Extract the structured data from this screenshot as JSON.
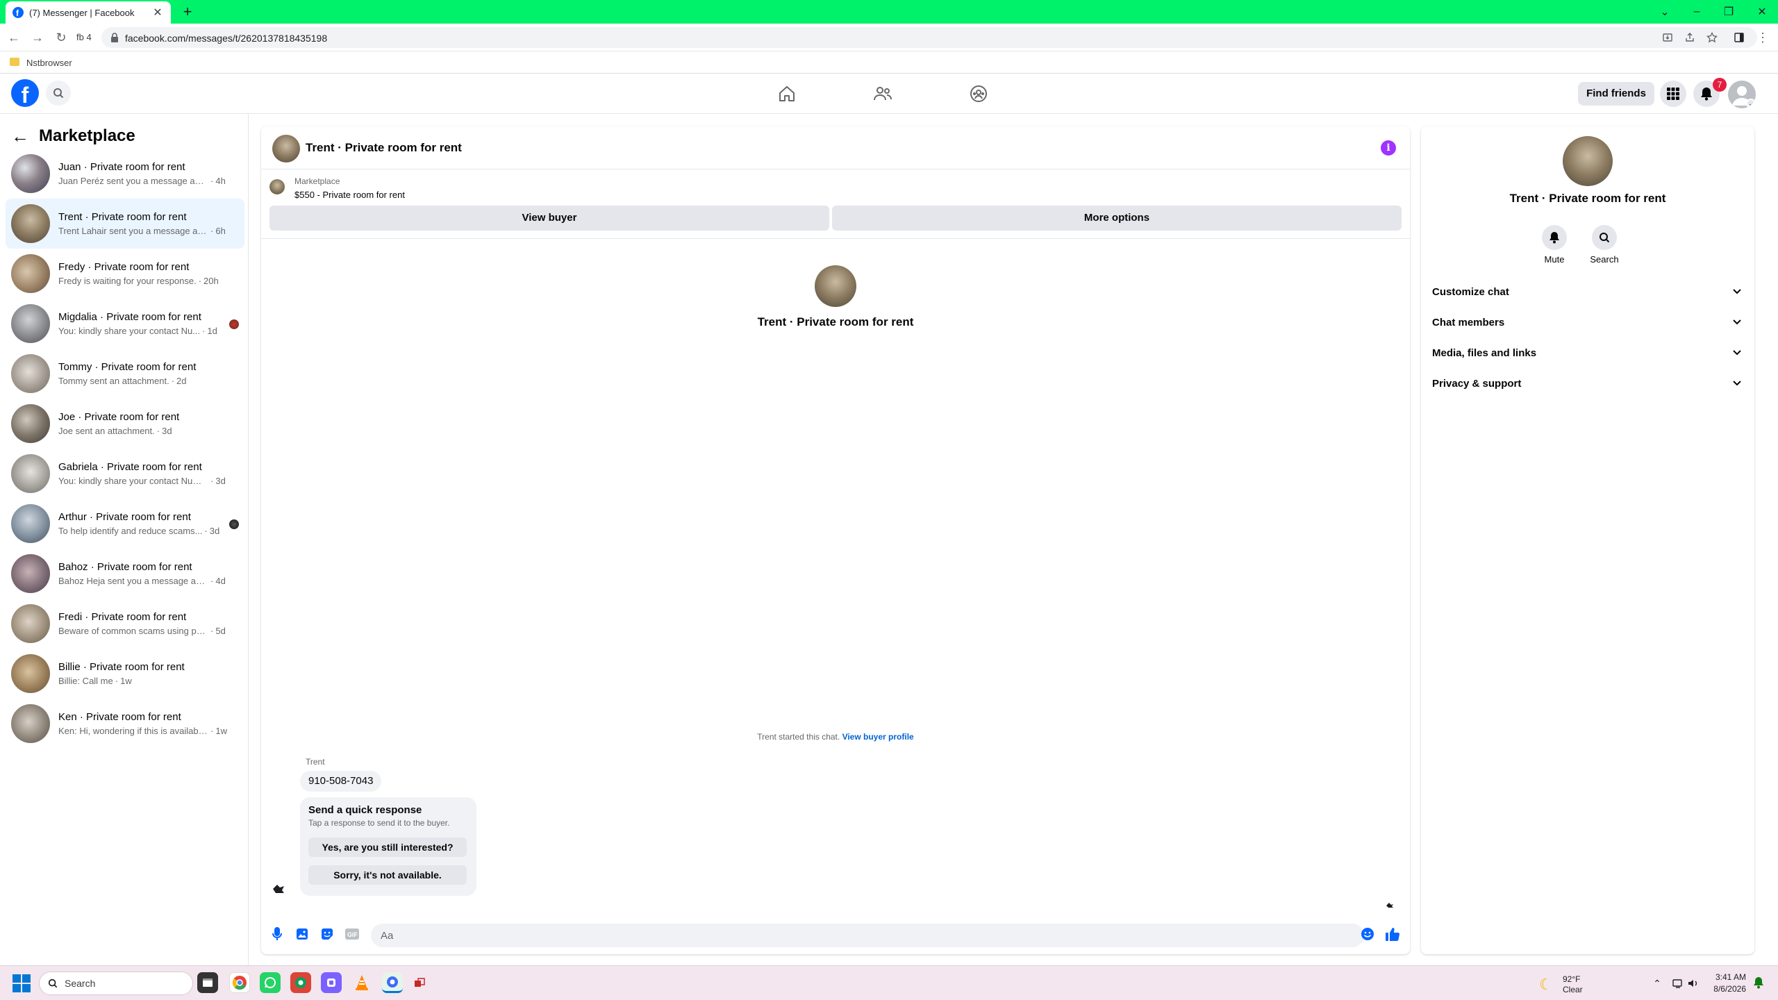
{
  "browser": {
    "tab_title": "(7) Messenger | Facebook",
    "url": "facebook.com/messages/t/2620137818435198",
    "profile_label": "fb 4",
    "bookmark_label": "Nstbrowser",
    "chrome_accent": "#00f26a"
  },
  "fb_nav": {
    "find_friends_label": "Find friends",
    "notification_count": "7",
    "brand_color": "#0866ff"
  },
  "sidebar": {
    "title": "Marketplace",
    "conversations": [
      {
        "name": "Juan · Private room for rent",
        "preview": "Juan Peréz sent you a message abo...",
        "time": "4h"
      },
      {
        "name": "Trent · Private room for rent",
        "preview": "Trent Lahair sent you a message ab...",
        "time": "6h"
      },
      {
        "name": "Fredy · Private room for rent",
        "preview": "Fredy is waiting for your response.",
        "time": "20h"
      },
      {
        "name": "Migdalia · Private room for rent",
        "preview": "You: kindly share your contact Nu...",
        "time": "1d"
      },
      {
        "name": "Tommy · Private room for rent",
        "preview": "Tommy sent an attachment.",
        "time": "2d"
      },
      {
        "name": "Joe · Private room for rent",
        "preview": "Joe sent an attachment.",
        "time": "3d"
      },
      {
        "name": "Gabriela · Private room for rent",
        "preview": "You: kindly share your contact Numb...",
        "time": "3d"
      },
      {
        "name": "Arthur · Private room for rent",
        "preview": "To help identify and reduce scams...",
        "time": "3d"
      },
      {
        "name": "Bahoz · Private room for rent",
        "preview": "Bahoz Heja sent you a message abo...",
        "time": "4d"
      },
      {
        "name": "Fredi · Private room for rent",
        "preview": "Beware of common scams using pay...",
        "time": "5d"
      },
      {
        "name": "Billie · Private room for rent",
        "preview": "Billie: Call me",
        "time": "1w"
      },
      {
        "name": "Ken · Private room for rent",
        "preview": "Ken: Hi, wondering if this is available...",
        "time": "1w"
      }
    ]
  },
  "chat": {
    "title": "Trent · Private room for rent",
    "listing_source": "Marketplace",
    "listing_price": "$550 - Private room for rent",
    "view_buyer_label": "View buyer",
    "more_options_label": "More options",
    "intro_title": "Trent · Private room for rent",
    "started_text": "Trent started this chat.",
    "view_profile_link": "View buyer profile",
    "sender_name": "Trent",
    "phone_message": "910-508-7043",
    "quick_title": "Send a quick response",
    "quick_subtitle": "Tap a response to send it to the buyer.",
    "quick_option_1": "Yes, are you still interested?",
    "quick_option_2": "Sorry, it's not available.",
    "input_placeholder": "Aa"
  },
  "info_panel": {
    "title": "Trent · Private room for rent",
    "mute_label": "Mute",
    "search_label": "Search",
    "sections": [
      "Customize chat",
      "Chat members",
      "Media, files and links",
      "Privacy & support"
    ]
  },
  "taskbar": {
    "search_label": "Search",
    "weather_temp": "92°F",
    "weather_cond": "Clear",
    "time": "3:41 AM",
    "date": "8/6/2026"
  }
}
